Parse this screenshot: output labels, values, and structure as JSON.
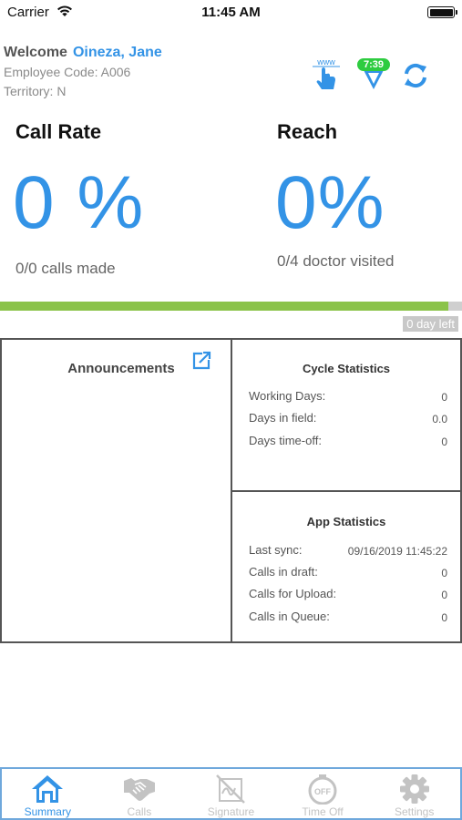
{
  "status_bar": {
    "carrier": "Carrier",
    "time": "11:45 AM"
  },
  "header": {
    "welcome_label": "Welcome",
    "user_name": "Oineza, Jane",
    "employee_code": "Employee Code: A006",
    "territory": "Territory: N",
    "www_label": "www",
    "timer": "7:39",
    "icons": [
      "www-hand-icon",
      "timer-location-icon",
      "sync-icon"
    ]
  },
  "call_rate": {
    "title": "Call Rate",
    "value": "0 %",
    "detail": "0/0 calls made"
  },
  "reach": {
    "title": "Reach",
    "value": "0%",
    "detail": "0/4 doctor visited"
  },
  "progress": {
    "fraction": 0.97,
    "days_left": "0 day left"
  },
  "announcements": {
    "title": "Announcements"
  },
  "cycle_statistics": {
    "title": "Cycle Statistics",
    "rows": [
      {
        "label": "Working Days:",
        "value": "0"
      },
      {
        "label": "Days in field:",
        "value": "0.0"
      },
      {
        "label": "Days time-off:",
        "value": "0"
      }
    ]
  },
  "app_statistics": {
    "title": "App Statistics",
    "rows": [
      {
        "label": "Last sync:",
        "value": "09/16/2019 11:45:22"
      },
      {
        "label": "Calls in draft:",
        "value": "0"
      },
      {
        "label": "Calls for Upload:",
        "value": "0"
      },
      {
        "label": "Calls in Queue:",
        "value": "0"
      }
    ]
  },
  "tabs": [
    {
      "label": "Summary",
      "icon": "home-icon",
      "active": true
    },
    {
      "label": "Calls",
      "icon": "handshake-icon",
      "active": false
    },
    {
      "label": "Signature",
      "icon": "signature-icon",
      "active": false
    },
    {
      "label": "Time Off",
      "icon": "time-off-icon",
      "active": false
    },
    {
      "label": "Settings",
      "icon": "gear-icon",
      "active": false
    }
  ],
  "colors": {
    "accent": "#3393e6",
    "progress": "#8bc34a",
    "timer": "#2ecc40",
    "inactive": "#c3c3c3"
  }
}
